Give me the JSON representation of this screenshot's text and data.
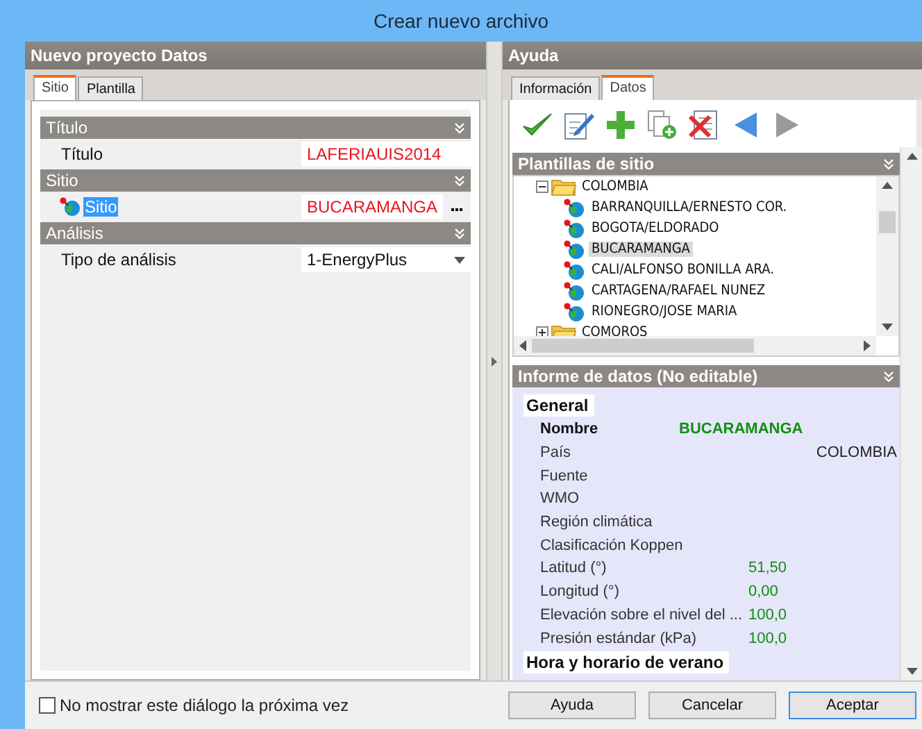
{
  "window": {
    "title": "Crear nuevo archivo"
  },
  "left_panel": {
    "title": "Nuevo proyecto Datos",
    "tabs": [
      {
        "label": "Sitio",
        "selected": true
      },
      {
        "label": "Plantilla",
        "selected": false
      }
    ],
    "categories": [
      {
        "name": "Título",
        "rows": [
          {
            "label": "Título",
            "value": "LAFERIAUIS2014",
            "kind": "text",
            "selected": false
          }
        ]
      },
      {
        "name": "Sitio",
        "rows": [
          {
            "label": "Sitio",
            "value": "BUCARAMANGA",
            "kind": "browse",
            "selected": true
          }
        ]
      },
      {
        "name": "Análisis",
        "rows": [
          {
            "label": "Tipo de análisis",
            "value": "1-EnergyPlus",
            "kind": "dropdown",
            "selected": false
          }
        ]
      }
    ]
  },
  "right_panel": {
    "title": "Ayuda",
    "tabs": [
      {
        "label": "Información",
        "selected": false
      },
      {
        "label": "Datos",
        "selected": true
      }
    ],
    "toolbar": [
      {
        "kind": "check",
        "disabled": false
      },
      {
        "kind": "edit",
        "disabled": false
      },
      {
        "kind": "add",
        "disabled": false
      },
      {
        "kind": "copy",
        "disabled": false
      },
      {
        "kind": "delete",
        "disabled": false
      },
      {
        "kind": "back",
        "disabled": false
      },
      {
        "kind": "forward",
        "disabled": true
      }
    ],
    "templates": {
      "title": "Plantillas de sitio",
      "tree": [
        {
          "label": "COLOMBIA",
          "kind": "folder",
          "expanded": true,
          "children": [
            {
              "label": "BARRANQUILLA/ERNESTO COR.",
              "kind": "site",
              "selected": false
            },
            {
              "label": "BOGOTA/ELDORADO",
              "kind": "site",
              "selected": false
            },
            {
              "label": "BUCARAMANGA",
              "kind": "site",
              "selected": true
            },
            {
              "label": "CALI/ALFONSO BONILLA ARA.",
              "kind": "site",
              "selected": false
            },
            {
              "label": "CARTAGENA/RAFAEL NUNEZ",
              "kind": "site",
              "selected": false
            },
            {
              "label": "RIONEGRO/JOSE MARIA",
              "kind": "site",
              "selected": false
            }
          ]
        },
        {
          "label": "COMOROS",
          "kind": "folder",
          "expanded": false
        }
      ]
    },
    "report": {
      "title": "Informe de datos (No editable)",
      "sections": [
        {
          "title": "General",
          "rows": [
            {
              "label": "Nombre",
              "value": "BUCARAMANGA",
              "kind": "name"
            },
            {
              "label": "País",
              "value": "COLOMBIA",
              "kind": "text"
            },
            {
              "label": "Fuente",
              "kind": "text"
            },
            {
              "label": "WMO",
              "kind": "text"
            },
            {
              "label": "Región climática",
              "kind": "text"
            },
            {
              "label": "Clasificación Koppen",
              "kind": "text"
            },
            {
              "label": "Latitud (°)",
              "value": "51,50",
              "kind": "number"
            },
            {
              "label": "Longitud (°)",
              "value": "0,00",
              "kind": "number"
            },
            {
              "label": "Elevación sobre el nivel del ...",
              "value": "100,0",
              "kind": "number"
            },
            {
              "label": "Presión estándar (kPa)",
              "value": "100,0",
              "kind": "number"
            }
          ]
        },
        {
          "title": "Hora y horario de verano"
        }
      ]
    }
  },
  "footer": {
    "checkbox": {
      "label": "No mostrar este diálogo la próxima vez",
      "checked": false
    },
    "buttons": [
      {
        "label": "Ayuda",
        "selected": false
      },
      {
        "label": "Cancelar",
        "selected": false
      },
      {
        "label": "Aceptar",
        "selected": true
      }
    ]
  }
}
